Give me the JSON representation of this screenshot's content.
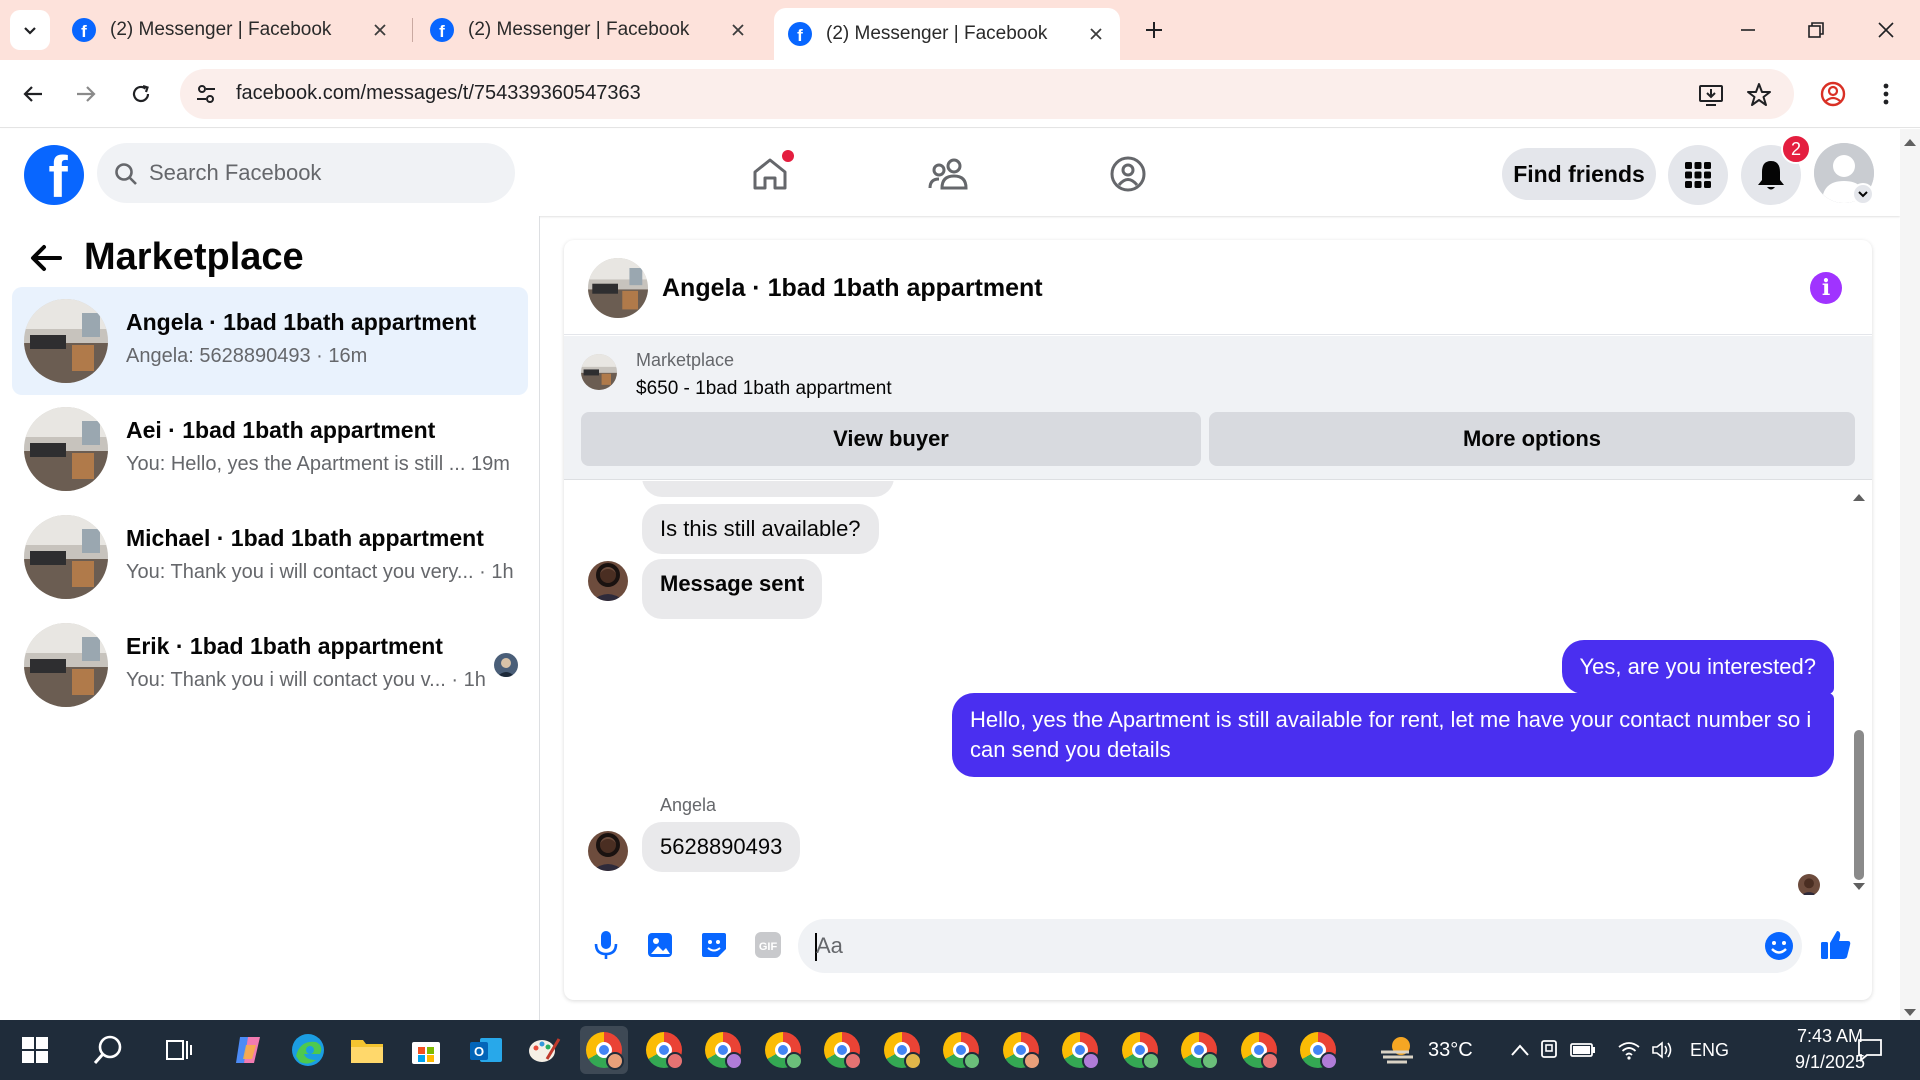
{
  "browser": {
    "tabs": [
      {
        "title": "(2) Messenger | Facebook",
        "active": false
      },
      {
        "title": "(2) Messenger | Facebook",
        "active": false
      },
      {
        "title": "(2) Messenger | Facebook",
        "active": true
      }
    ],
    "url": "facebook.com/messages/t/754339360547363"
  },
  "fb": {
    "search_placeholder": "Search Facebook",
    "find_friends": "Find friends",
    "notification_count": "2",
    "brand_color": "#0866ff"
  },
  "sidebar": {
    "title": "Marketplace",
    "conversations": [
      {
        "name": "Angela · 1bad 1bath appartment",
        "preview": "Angela: 5628890493 · 16m",
        "selected": true
      },
      {
        "name": "Aei · 1bad 1bath appartment",
        "preview": "You: Hello, yes the Apartment is still ...  19m",
        "selected": false
      },
      {
        "name": "Michael · 1bad 1bath appartment",
        "preview": "You: Thank you i will contact you very... · 1h",
        "selected": false
      },
      {
        "name": "Erik · 1bad 1bath appartment",
        "preview": "You: Thank you i will contact you v...  · 1h",
        "selected": false
      }
    ]
  },
  "chat": {
    "title": "Angela · 1bad 1bath appartment",
    "listing": {
      "label": "Marketplace",
      "price_title": "$650 - 1bad 1bath appartment",
      "view_buyer": "View buyer",
      "more_options": "More options"
    },
    "messages": [
      {
        "from": "them",
        "text": "Is this still available?"
      },
      {
        "from": "them",
        "text": "Message sent"
      },
      {
        "from": "me",
        "text": "Yes, are you interested?"
      },
      {
        "from": "me",
        "text": "Hello, yes the Apartment is still available for rent, let me have your contact number so i can send you details"
      },
      {
        "from": "them",
        "sender": "Angela",
        "text": "5628890493"
      }
    ],
    "composer_placeholder": "Aa",
    "accent_color": "#4a2ff0"
  },
  "taskbar": {
    "weather": "33°C",
    "language": "ENG",
    "time": "7:43 AM",
    "date": "9/1/2025"
  }
}
